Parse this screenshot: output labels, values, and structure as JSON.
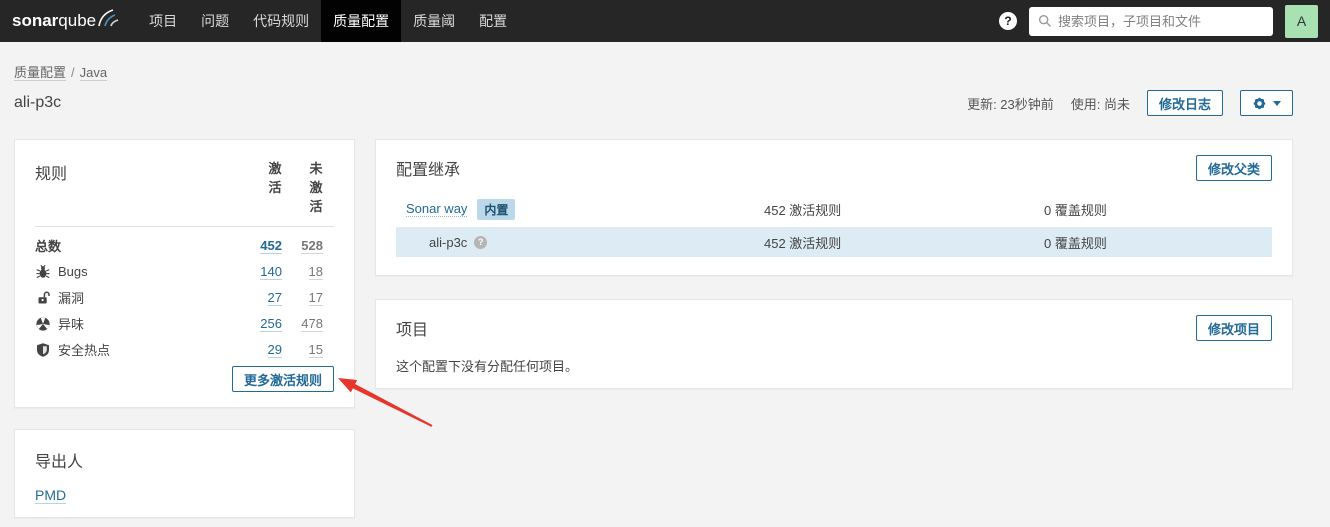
{
  "navbar": {
    "logo_bold": "sonar",
    "logo_light": "qube",
    "items": [
      {
        "label": "项目",
        "active": false
      },
      {
        "label": "问题",
        "active": false
      },
      {
        "label": "代码规则",
        "active": false
      },
      {
        "label": "质量配置",
        "active": true
      },
      {
        "label": "质量阈",
        "active": false
      },
      {
        "label": "配置",
        "active": false
      }
    ],
    "help": "?",
    "search_placeholder": "搜索项目，子项目和文件",
    "avatar": "A"
  },
  "header": {
    "breadcrumb_profile": "质量配置",
    "breadcrumb_sep": "/",
    "breadcrumb_lang": "Java",
    "title": "ali-p3c",
    "updated": "更新: 23秒钟前",
    "used": "使用: 尚未",
    "changelog_button": "修改日志"
  },
  "rules": {
    "title": "规则",
    "col_active": "激活",
    "col_inactive": "未激活",
    "rows": [
      {
        "label": "总数",
        "icon": "",
        "active": "452",
        "inactive": "528"
      },
      {
        "label": "Bugs",
        "icon": "bug-icon",
        "active": "140",
        "inactive": "18"
      },
      {
        "label": "漏洞",
        "icon": "vulnerability-icon",
        "active": "27",
        "inactive": "17"
      },
      {
        "label": "异味",
        "icon": "code-smell-icon",
        "active": "256",
        "inactive": "478"
      },
      {
        "label": "安全热点",
        "icon": "security-hotspot-icon",
        "active": "29",
        "inactive": "15"
      }
    ],
    "more_button": "更多激活规则"
  },
  "exporters": {
    "title": "导出人",
    "pmd_link": "PMD"
  },
  "inheritance": {
    "title": "配置继承",
    "change_parent_button": "修改父类",
    "rows": [
      {
        "name": "Sonar way",
        "badge": "内置",
        "active": "452 激活规则",
        "overridden": "0 覆盖规则"
      },
      {
        "name": "ali-p3c",
        "help": "?",
        "active": "452 激活规则",
        "overridden": "0 覆盖规则"
      }
    ]
  },
  "projects": {
    "title": "项目",
    "change_button": "修改项目",
    "empty": "这个配置下没有分配任何项目。"
  },
  "colors": {
    "accent_blue": "#236a97",
    "navbar_bg": "#262626",
    "active_tab_bg": "#020202",
    "highlight_row": "#dcebf4",
    "badge_bg": "#bcd9ec",
    "arrow_red": "#e8352b",
    "avatar_green": "#a9e2b2",
    "page_bg": "#f3f3f3"
  }
}
